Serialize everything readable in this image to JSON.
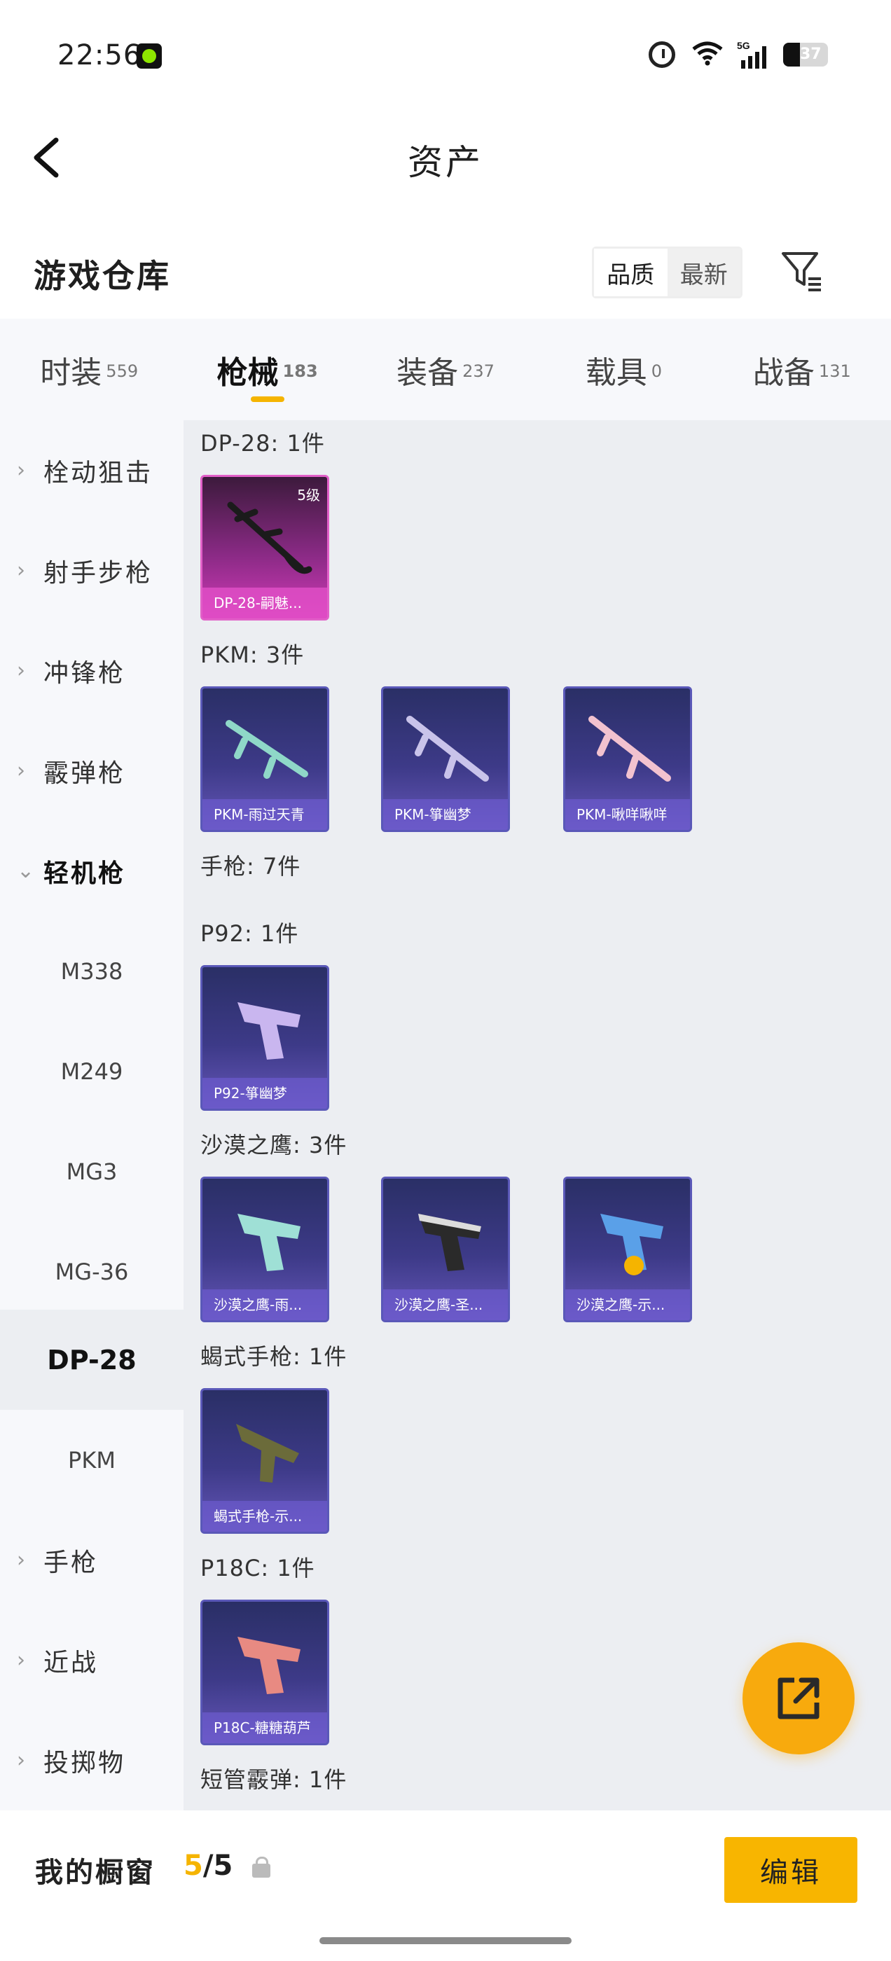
{
  "status_bar": {
    "time": "22:56",
    "battery": "37",
    "battery_level": 0.37,
    "network": "5G"
  },
  "header": {
    "title": "资产"
  },
  "warehouse": {
    "title": "游戏仓库",
    "sort_options": [
      "品质",
      "最新"
    ]
  },
  "tabs": [
    {
      "label": "时装",
      "count": "559"
    },
    {
      "label": "枪械",
      "count": "183",
      "active": true
    },
    {
      "label": "装备",
      "count": "237"
    },
    {
      "label": "载具",
      "count": "0"
    },
    {
      "label": "战备",
      "count": "131"
    }
  ],
  "sidebar": {
    "items": [
      {
        "label": "栓动狙击",
        "type": "category"
      },
      {
        "label": "射手步枪",
        "type": "category"
      },
      {
        "label": "冲锋枪",
        "type": "category"
      },
      {
        "label": "霰弹枪",
        "type": "category"
      },
      {
        "label": "轻机枪",
        "type": "category-expanded"
      },
      {
        "label": "M338",
        "type": "sub"
      },
      {
        "label": "M249",
        "type": "sub"
      },
      {
        "label": "MG3",
        "type": "sub"
      },
      {
        "label": "MG-36",
        "type": "sub"
      },
      {
        "label": "DP-28",
        "type": "sub-selected"
      },
      {
        "label": "PKM",
        "type": "sub"
      },
      {
        "label": "手枪",
        "type": "category"
      },
      {
        "label": "近战",
        "type": "category"
      },
      {
        "label": "投掷物",
        "type": "category"
      }
    ]
  },
  "content": {
    "sections": [
      {
        "title": "DP-28: 1件",
        "cards": [
          {
            "name": "DP-28-嗣魅...",
            "level": "5级",
            "rarity": "pink",
            "weapon": "lmg"
          }
        ]
      },
      {
        "title": "PKM: 3件",
        "cards": [
          {
            "name": "PKM-雨过天青",
            "rarity": "purple",
            "weapon": "lmg"
          },
          {
            "name": "PKM-箏幽梦",
            "rarity": "purple",
            "weapon": "lmg"
          },
          {
            "name": "PKM-啾咩啾咩",
            "rarity": "purple",
            "weapon": "lmg"
          }
        ]
      },
      {
        "title": "手枪: 7件",
        "cards": []
      },
      {
        "title": "P92: 1件",
        "cards": [
          {
            "name": "P92-箏幽梦",
            "rarity": "purple",
            "weapon": "pistol"
          }
        ]
      },
      {
        "title": "沙漠之鹰: 3件",
        "cards": [
          {
            "name": "沙漠之鹰-雨...",
            "rarity": "purple",
            "weapon": "pistol"
          },
          {
            "name": "沙漠之鹰-圣...",
            "rarity": "purple",
            "weapon": "pistol"
          },
          {
            "name": "沙漠之鹰-示...",
            "rarity": "purple",
            "weapon": "pistol"
          }
        ]
      },
      {
        "title": "蝎式手枪: 1件",
        "cards": [
          {
            "name": "蝎式手枪-示...",
            "rarity": "purple",
            "weapon": "smg"
          }
        ]
      },
      {
        "title": "P18C: 1件",
        "cards": [
          {
            "name": "P18C-糖糖葫芦",
            "rarity": "purple",
            "weapon": "pistol"
          }
        ]
      },
      {
        "title": "短管霰弹: 1件",
        "cards": []
      }
    ]
  },
  "fab": {
    "icon": "share-icon"
  },
  "bottom": {
    "showcase_label": "我的橱窗",
    "count_current": "5",
    "count_sep_total": "/5",
    "edit_label": "编辑"
  },
  "colors": {
    "accent": "#f5b400",
    "fab": "#f8aa0d",
    "panel_bg": "#eceef2",
    "sidebar_bg": "#f7f8fb"
  }
}
